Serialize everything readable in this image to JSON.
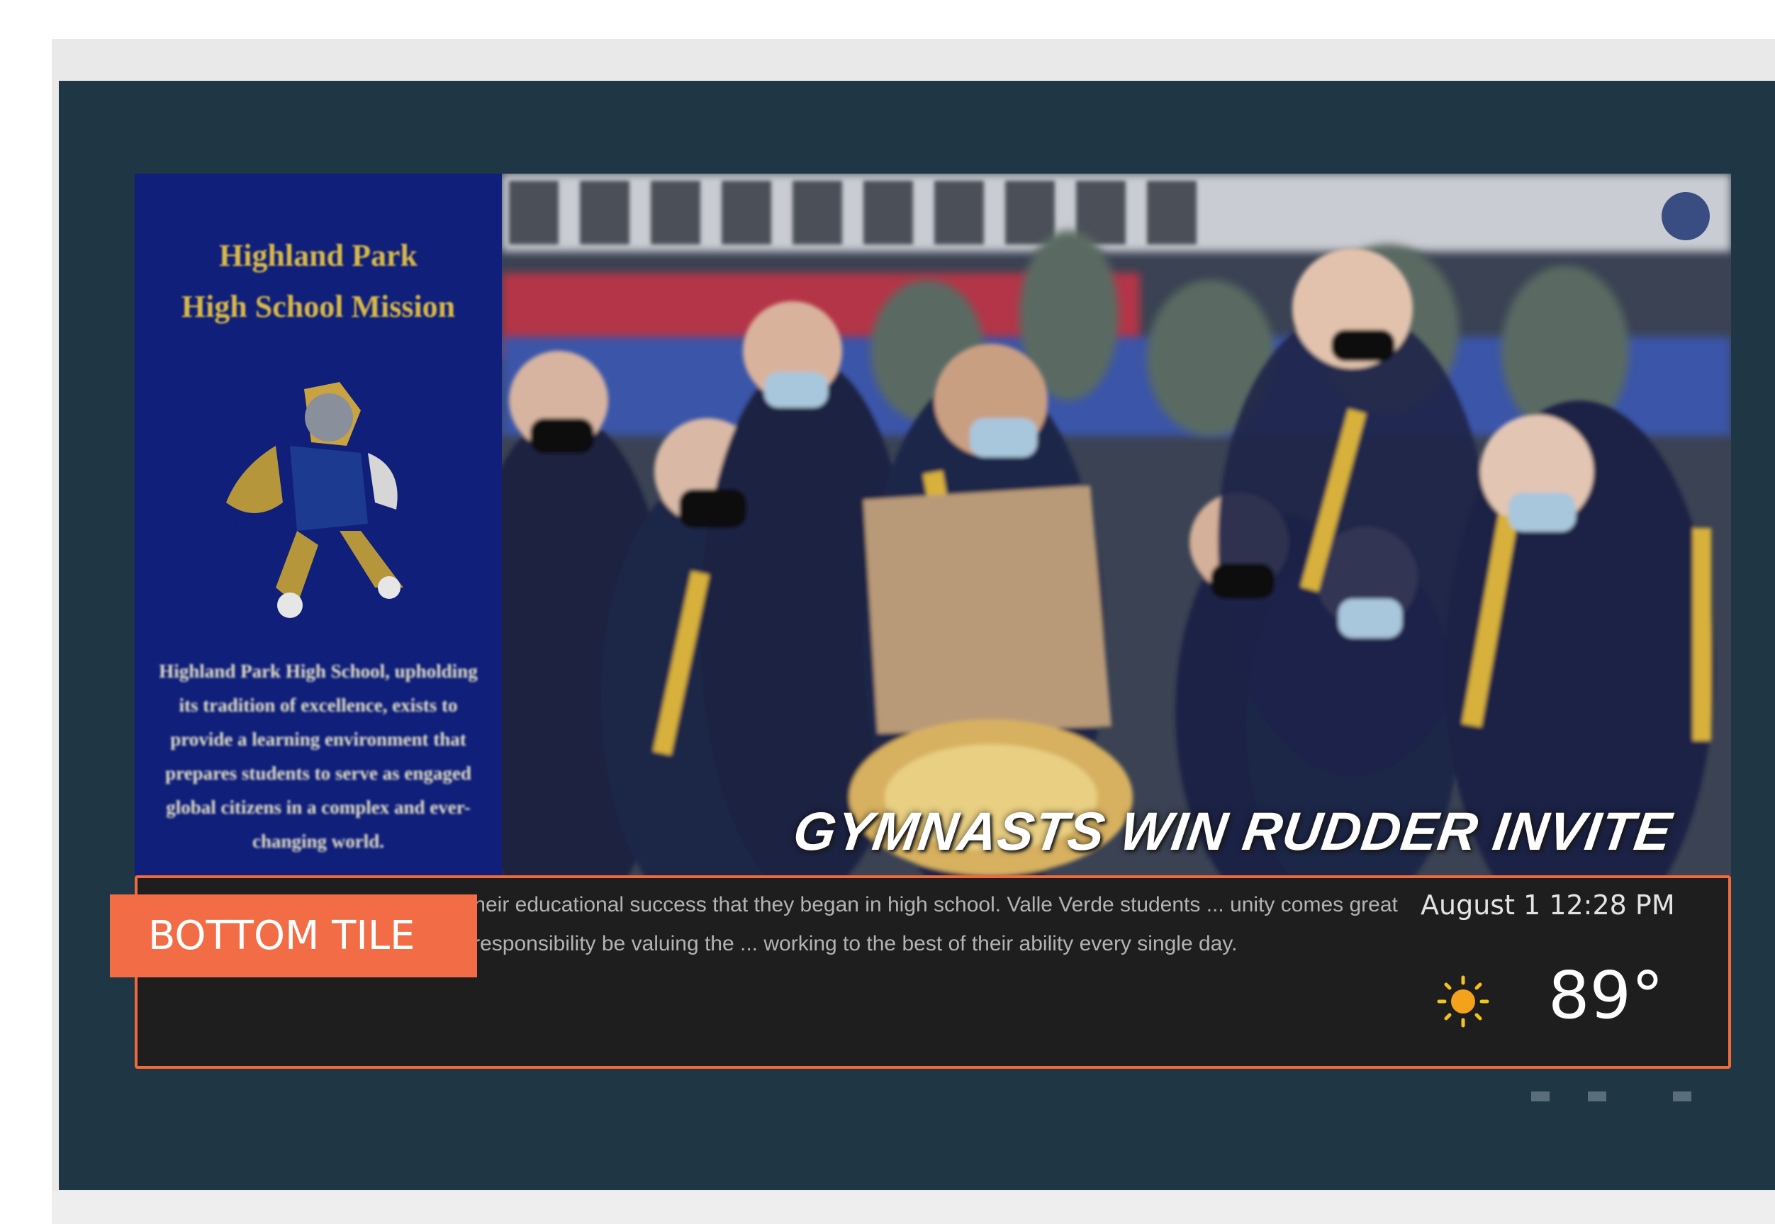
{
  "mission_panel": {
    "title_line1": "Highland Park",
    "title_line2": "High School Mission",
    "body": "Highland Park High School, upholding its tradition of excellence, exists to provide a learning environment that prepares students to serve as engaged global citizens in a complex and ever-changing world."
  },
  "photo": {
    "caption": "GYMNASTS WIN RUDDER INVITE"
  },
  "bottom_tile": {
    "label": "BOTTOM TILE",
    "ticker_text": "Verde ECHS graduates continue their educational success that they began in high school. Valle Verde students ... unity comes great responsibility. They live up to that responsibility be valuing the ... working to the best of their ability every single day.",
    "datetime": "August 1 12:28 PM",
    "temperature": "89°",
    "weather_icon": "sun-icon"
  },
  "colors": {
    "accent": "#f06a3c",
    "screen_bg": "#1f3644",
    "mission_bg": "#0f1f7a",
    "gold": "#d9b948"
  }
}
